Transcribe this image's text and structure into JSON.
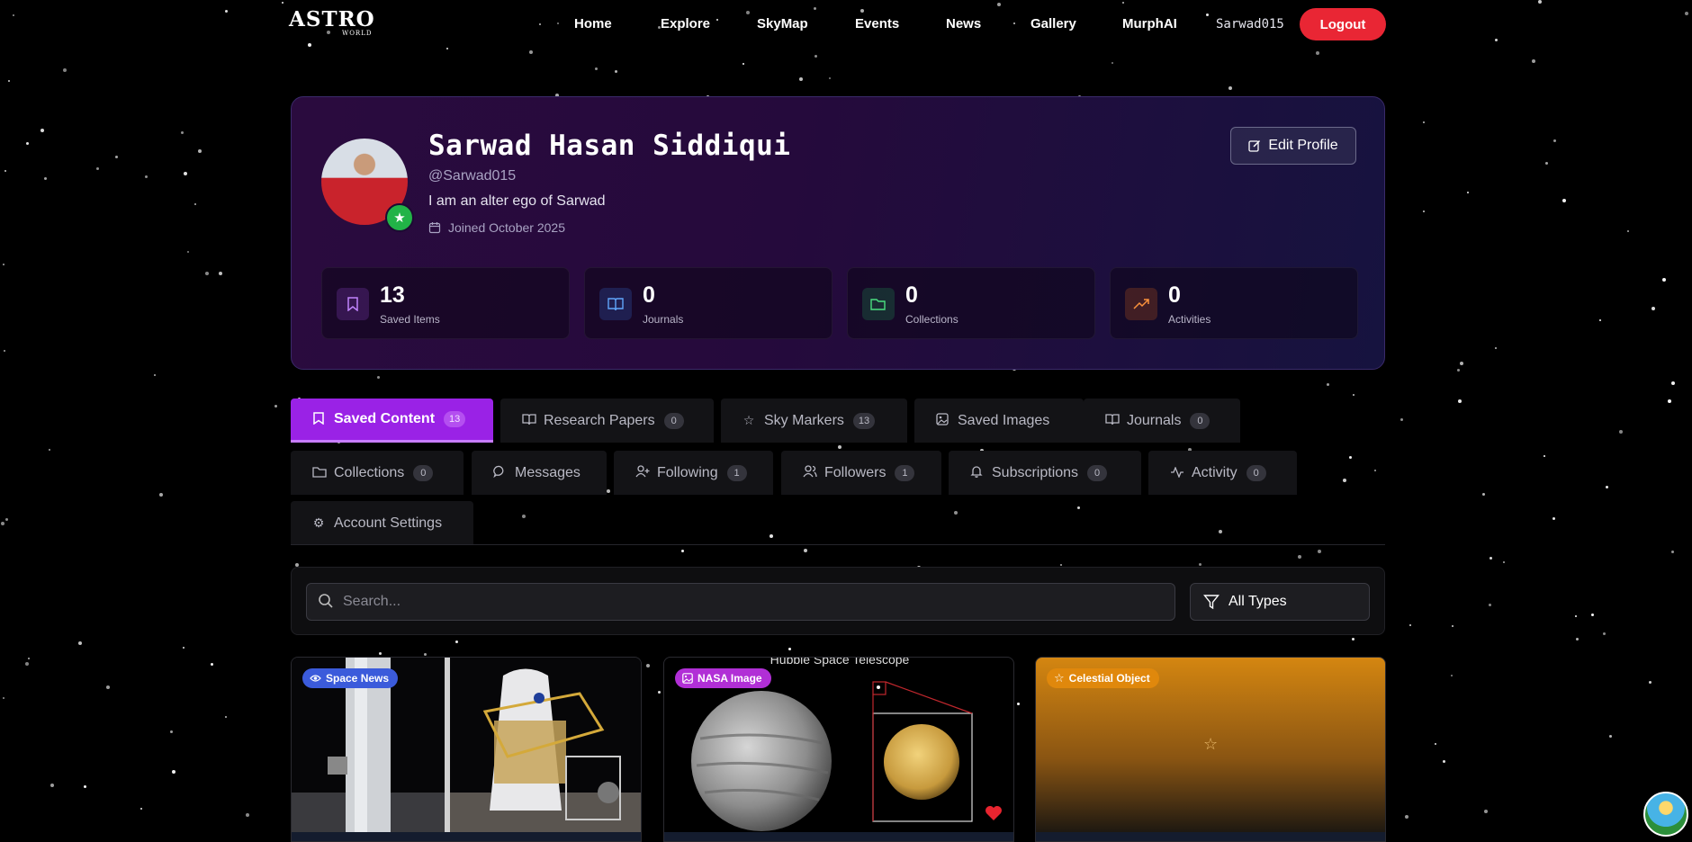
{
  "nav": {
    "logo_main": "ASTRO",
    "logo_sub": "WORLD",
    "links": [
      "Home",
      "Explore",
      "SkyMap",
      "Events",
      "News",
      "Gallery",
      "MurphAI"
    ],
    "username": "Sarwad015",
    "logout": "Logout"
  },
  "profile": {
    "name": "Sarwad Hasan Siddiqui",
    "handle": "@Sarwad015",
    "bio": "I am an alter ego of Sarwad",
    "joined": "Joined October 2025",
    "edit_label": "Edit Profile",
    "stats": [
      {
        "value": "13",
        "label": "Saved Items"
      },
      {
        "value": "0",
        "label": "Journals"
      },
      {
        "value": "0",
        "label": "Collections"
      },
      {
        "value": "0",
        "label": "Activities"
      }
    ]
  },
  "tabs": [
    {
      "label": "Saved Content",
      "count": "13"
    },
    {
      "label": "Research Papers",
      "count": "0"
    },
    {
      "label": "Sky Markers",
      "count": "13"
    },
    {
      "label": "Saved Images"
    },
    {
      "label": "Journals",
      "count": "0"
    },
    {
      "label": "Collections",
      "count": "0"
    },
    {
      "label": "Messages"
    },
    {
      "label": "Following",
      "count": "1"
    },
    {
      "label": "Followers",
      "count": "1"
    },
    {
      "label": "Subscriptions",
      "count": "0"
    },
    {
      "label": "Activity",
      "count": "0"
    },
    {
      "label": "Account Settings"
    }
  ],
  "search": {
    "placeholder": "Search...",
    "filter_label": "All Types"
  },
  "cards": [
    {
      "badge": "Space News",
      "badge_color": "#3b5bdb"
    },
    {
      "badge": "NASA Image",
      "badge_color": "#b12fd6",
      "caption": "Hubble Space Telescope"
    },
    {
      "badge": "Celestial Object",
      "badge_color": "#e0880c"
    }
  ],
  "colors": {
    "accent": "#9a22e6",
    "logout": "#e92634",
    "saved_icon": "#a855f7",
    "journals_icon": "#3b82f6",
    "collections_icon": "#22c55e",
    "activities_icon": "#f97316"
  }
}
